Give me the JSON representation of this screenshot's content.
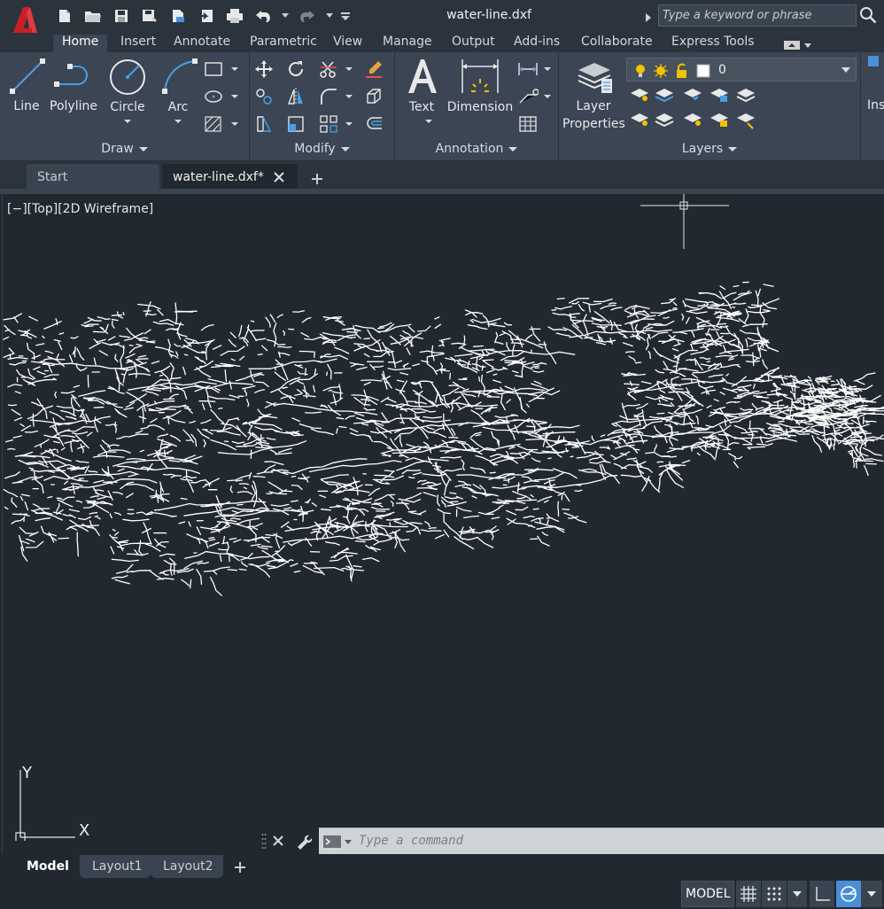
{
  "title_bar": {
    "app_logo_letter": "A",
    "document_title": "water-line.dxf",
    "search_placeholder": "Type a keyword or phrase"
  },
  "quick_access": [
    "new-icon",
    "open-icon",
    "save-icon",
    "save-as-icon",
    "open-web-icon",
    "save-web-icon",
    "plot-icon",
    "undo-icon",
    "redo-icon",
    "customize-icon"
  ],
  "ribbon_tabs": [
    "Home",
    "Insert",
    "Annotate",
    "Parametric",
    "View",
    "Manage",
    "Output",
    "Add-ins",
    "Collaborate",
    "Express Tools"
  ],
  "active_ribbon_tab": "Home",
  "ribbon": {
    "draw": {
      "title": "Draw",
      "line": "Line",
      "polyline": "Polyline",
      "circle": "Circle",
      "arc": "Arc"
    },
    "modify": {
      "title": "Modify"
    },
    "annotation": {
      "title": "Annotation",
      "text": "Text",
      "dimension": "Dimension"
    },
    "layers": {
      "title": "Layers",
      "layer_properties_1": "Layer",
      "layer_properties_2": "Properties",
      "current_layer": "0"
    },
    "block": {
      "insert_partial": "Ins"
    }
  },
  "file_tabs": {
    "start": "Start",
    "current": "water-line.dxf*"
  },
  "viewport": {
    "view_label": "[−][Top][2D Wireframe]",
    "ucs_x": "X",
    "ucs_y": "Y"
  },
  "command_line": {
    "placeholder": "Type a command"
  },
  "layout_tabs": {
    "model": "Model",
    "layout1": "Layout1",
    "layout2": "Layout2"
  },
  "status_bar": {
    "model": "MODEL"
  },
  "colors": {
    "background": "#212830",
    "ribbon": "#3b4553",
    "logo_red": "#c8202a",
    "accent_blue": "#4a90d9"
  }
}
